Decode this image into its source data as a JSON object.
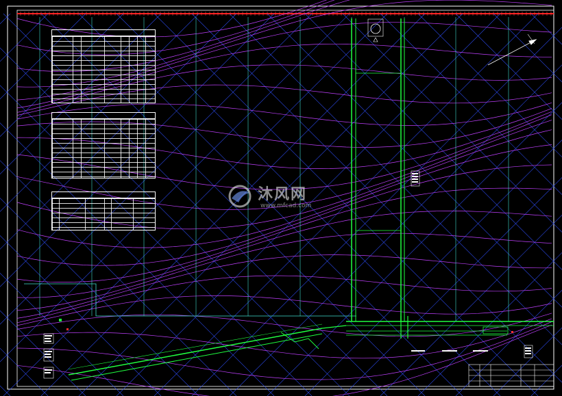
{
  "watermark": {
    "brand_cn": "沐风网",
    "url": "www.mfcad.com"
  },
  "colors": {
    "frame": "#ffffff",
    "top_line": "#ff2020",
    "contour": "#c040ff",
    "grid": "#3050ff",
    "section_lines": "#40e0d0",
    "alignment": "#20ff40",
    "label": "#ffffff"
  },
  "drawing": {
    "tables": [
      {
        "name": "legend-table-1",
        "rows": 10,
        "cols": 7
      },
      {
        "name": "legend-table-2",
        "rows": 11,
        "cols": 7
      },
      {
        "name": "legend-table-3",
        "rows": 6,
        "cols": 6
      }
    ]
  }
}
